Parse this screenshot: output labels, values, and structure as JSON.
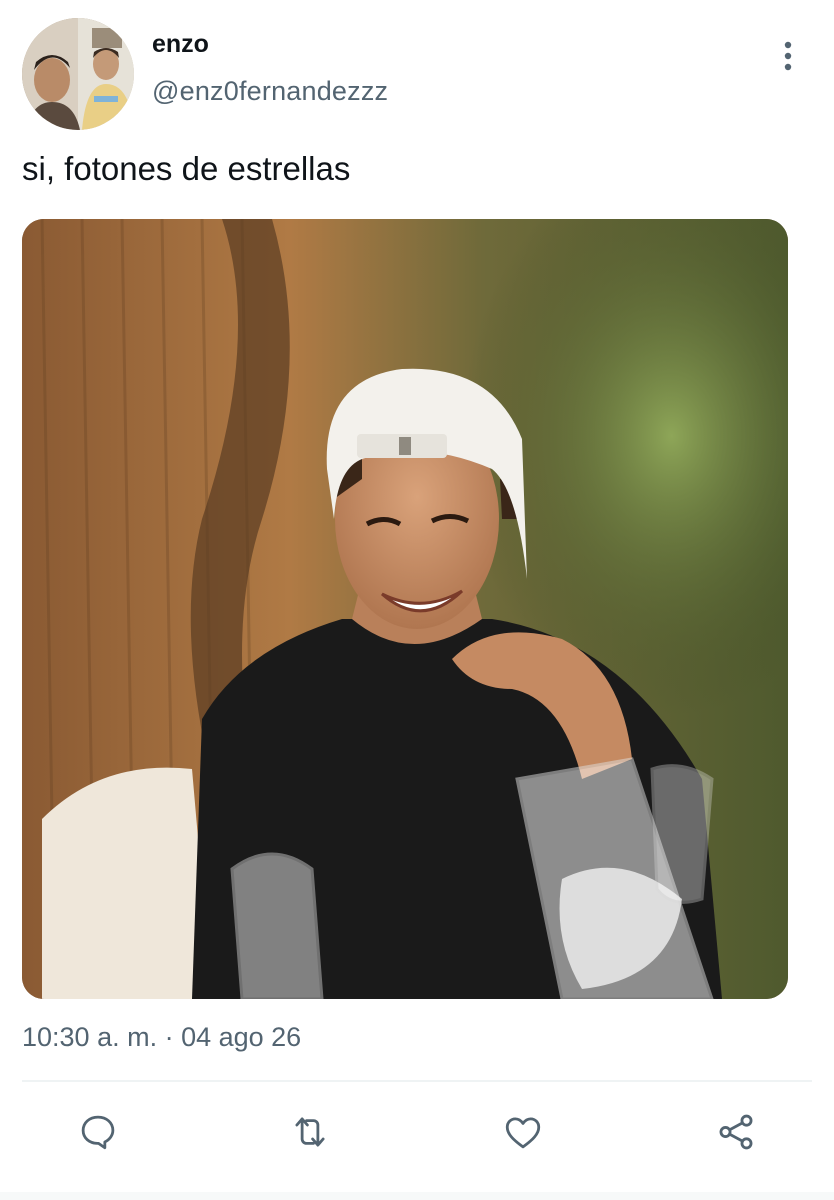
{
  "author": {
    "display_name": "enzo",
    "handle": "@enz0fernandezzz",
    "avatar_icon": "avatar-photo"
  },
  "tweet": {
    "text": "si, fotones de estrellas",
    "timestamp": "10:30 a. m. · 04 ago 26",
    "media_icon": "photo-smiling-man-white-cap"
  },
  "actions": {
    "reply_icon": "reply-icon",
    "retweet_icon": "retweet-icon",
    "like_icon": "heart-icon",
    "share_icon": "share-icon",
    "more_icon": "more-vertical-icon"
  },
  "colors": {
    "text": "#0f1419",
    "secondary": "#536471",
    "divider": "#eff3f4"
  }
}
